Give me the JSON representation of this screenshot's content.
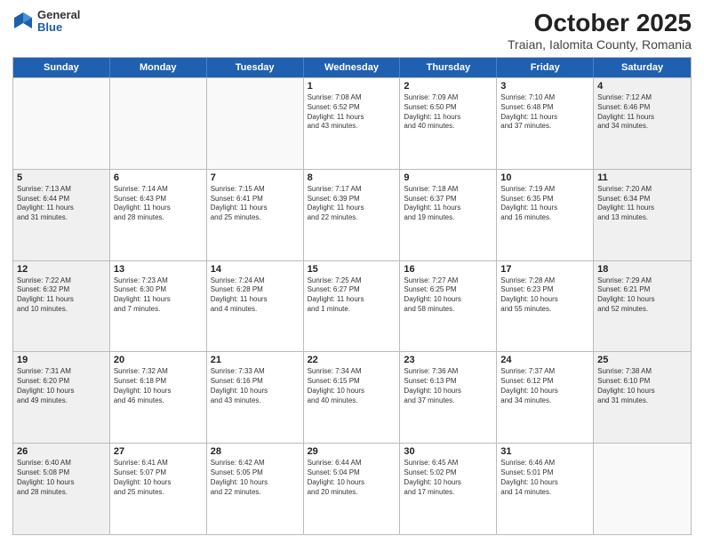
{
  "header": {
    "logo_general": "General",
    "logo_blue": "Blue",
    "title": "October 2025",
    "subtitle": "Traian, Ialomita County, Romania"
  },
  "days_of_week": [
    "Sunday",
    "Monday",
    "Tuesday",
    "Wednesday",
    "Thursday",
    "Friday",
    "Saturday"
  ],
  "weeks": [
    [
      {
        "day": "",
        "text": "",
        "empty": true
      },
      {
        "day": "",
        "text": "",
        "empty": true
      },
      {
        "day": "",
        "text": "",
        "empty": true
      },
      {
        "day": "1",
        "text": "Sunrise: 7:08 AM\nSunset: 6:52 PM\nDaylight: 11 hours\nand 43 minutes.",
        "empty": false
      },
      {
        "day": "2",
        "text": "Sunrise: 7:09 AM\nSunset: 6:50 PM\nDaylight: 11 hours\nand 40 minutes.",
        "empty": false
      },
      {
        "day": "3",
        "text": "Sunrise: 7:10 AM\nSunset: 6:48 PM\nDaylight: 11 hours\nand 37 minutes.",
        "empty": false
      },
      {
        "day": "4",
        "text": "Sunrise: 7:12 AM\nSunset: 6:46 PM\nDaylight: 11 hours\nand 34 minutes.",
        "empty": false,
        "shaded": true
      }
    ],
    [
      {
        "day": "5",
        "text": "Sunrise: 7:13 AM\nSunset: 6:44 PM\nDaylight: 11 hours\nand 31 minutes.",
        "empty": false,
        "shaded": true
      },
      {
        "day": "6",
        "text": "Sunrise: 7:14 AM\nSunset: 6:43 PM\nDaylight: 11 hours\nand 28 minutes.",
        "empty": false
      },
      {
        "day": "7",
        "text": "Sunrise: 7:15 AM\nSunset: 6:41 PM\nDaylight: 11 hours\nand 25 minutes.",
        "empty": false
      },
      {
        "day": "8",
        "text": "Sunrise: 7:17 AM\nSunset: 6:39 PM\nDaylight: 11 hours\nand 22 minutes.",
        "empty": false
      },
      {
        "day": "9",
        "text": "Sunrise: 7:18 AM\nSunset: 6:37 PM\nDaylight: 11 hours\nand 19 minutes.",
        "empty": false
      },
      {
        "day": "10",
        "text": "Sunrise: 7:19 AM\nSunset: 6:35 PM\nDaylight: 11 hours\nand 16 minutes.",
        "empty": false
      },
      {
        "day": "11",
        "text": "Sunrise: 7:20 AM\nSunset: 6:34 PM\nDaylight: 11 hours\nand 13 minutes.",
        "empty": false,
        "shaded": true
      }
    ],
    [
      {
        "day": "12",
        "text": "Sunrise: 7:22 AM\nSunset: 6:32 PM\nDaylight: 11 hours\nand 10 minutes.",
        "empty": false,
        "shaded": true
      },
      {
        "day": "13",
        "text": "Sunrise: 7:23 AM\nSunset: 6:30 PM\nDaylight: 11 hours\nand 7 minutes.",
        "empty": false
      },
      {
        "day": "14",
        "text": "Sunrise: 7:24 AM\nSunset: 6:28 PM\nDaylight: 11 hours\nand 4 minutes.",
        "empty": false
      },
      {
        "day": "15",
        "text": "Sunrise: 7:25 AM\nSunset: 6:27 PM\nDaylight: 11 hours\nand 1 minute.",
        "empty": false
      },
      {
        "day": "16",
        "text": "Sunrise: 7:27 AM\nSunset: 6:25 PM\nDaylight: 10 hours\nand 58 minutes.",
        "empty": false
      },
      {
        "day": "17",
        "text": "Sunrise: 7:28 AM\nSunset: 6:23 PM\nDaylight: 10 hours\nand 55 minutes.",
        "empty": false
      },
      {
        "day": "18",
        "text": "Sunrise: 7:29 AM\nSunset: 6:21 PM\nDaylight: 10 hours\nand 52 minutes.",
        "empty": false,
        "shaded": true
      }
    ],
    [
      {
        "day": "19",
        "text": "Sunrise: 7:31 AM\nSunset: 6:20 PM\nDaylight: 10 hours\nand 49 minutes.",
        "empty": false,
        "shaded": true
      },
      {
        "day": "20",
        "text": "Sunrise: 7:32 AM\nSunset: 6:18 PM\nDaylight: 10 hours\nand 46 minutes.",
        "empty": false
      },
      {
        "day": "21",
        "text": "Sunrise: 7:33 AM\nSunset: 6:16 PM\nDaylight: 10 hours\nand 43 minutes.",
        "empty": false
      },
      {
        "day": "22",
        "text": "Sunrise: 7:34 AM\nSunset: 6:15 PM\nDaylight: 10 hours\nand 40 minutes.",
        "empty": false
      },
      {
        "day": "23",
        "text": "Sunrise: 7:36 AM\nSunset: 6:13 PM\nDaylight: 10 hours\nand 37 minutes.",
        "empty": false
      },
      {
        "day": "24",
        "text": "Sunrise: 7:37 AM\nSunset: 6:12 PM\nDaylight: 10 hours\nand 34 minutes.",
        "empty": false
      },
      {
        "day": "25",
        "text": "Sunrise: 7:38 AM\nSunset: 6:10 PM\nDaylight: 10 hours\nand 31 minutes.",
        "empty": false,
        "shaded": true
      }
    ],
    [
      {
        "day": "26",
        "text": "Sunrise: 6:40 AM\nSunset: 5:08 PM\nDaylight: 10 hours\nand 28 minutes.",
        "empty": false,
        "shaded": true
      },
      {
        "day": "27",
        "text": "Sunrise: 6:41 AM\nSunset: 5:07 PM\nDaylight: 10 hours\nand 25 minutes.",
        "empty": false
      },
      {
        "day": "28",
        "text": "Sunrise: 6:42 AM\nSunset: 5:05 PM\nDaylight: 10 hours\nand 22 minutes.",
        "empty": false
      },
      {
        "day": "29",
        "text": "Sunrise: 6:44 AM\nSunset: 5:04 PM\nDaylight: 10 hours\nand 20 minutes.",
        "empty": false
      },
      {
        "day": "30",
        "text": "Sunrise: 6:45 AM\nSunset: 5:02 PM\nDaylight: 10 hours\nand 17 minutes.",
        "empty": false
      },
      {
        "day": "31",
        "text": "Sunrise: 6:46 AM\nSunset: 5:01 PM\nDaylight: 10 hours\nand 14 minutes.",
        "empty": false
      },
      {
        "day": "",
        "text": "",
        "empty": true
      }
    ]
  ]
}
